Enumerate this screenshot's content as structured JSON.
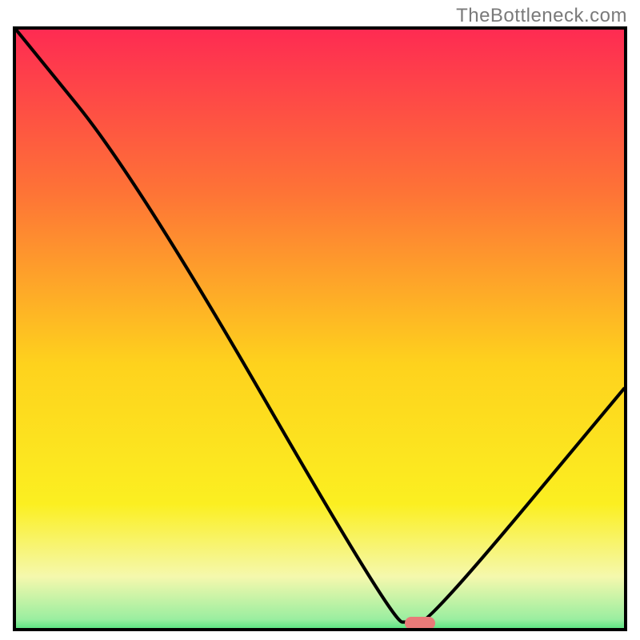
{
  "attribution": "TheBottleneck.com",
  "colors": {
    "frame": "#000000",
    "grad_top": "#fe2b52",
    "grad_upper_mid": "#fe8933",
    "grad_mid": "#fed21f",
    "grad_lower_mid": "#fbef21",
    "grad_pale": "#f5f8ad",
    "grad_green": "#1ddb65",
    "curve": "#000000",
    "marker": "#e87a78"
  },
  "layout": {
    "frame_left": 16,
    "frame_top": 33,
    "frame_width": 768,
    "frame_height": 756
  },
  "chart_data": {
    "type": "line",
    "title": "",
    "xlabel": "",
    "ylabel": "",
    "xlim": [
      0,
      100
    ],
    "ylim": [
      0,
      100
    ],
    "series": [
      {
        "name": "bottleneck-curve",
        "x": [
          0,
          20,
          62,
          65,
          68,
          100
        ],
        "values": [
          100,
          75,
          1,
          1,
          1,
          40
        ]
      }
    ],
    "marker": {
      "x_center": 66.5,
      "y": 0.8,
      "width_pct": 5
    },
    "background_gradient_stops": [
      {
        "pct": 0,
        "color": "#fe2b52"
      },
      {
        "pct": 27,
        "color": "#fe7436"
      },
      {
        "pct": 55,
        "color": "#fed21d"
      },
      {
        "pct": 78,
        "color": "#fbef21"
      },
      {
        "pct": 90,
        "color": "#f5f8ad"
      },
      {
        "pct": 97,
        "color": "#9aeea0"
      },
      {
        "pct": 100,
        "color": "#1ddb65"
      }
    ]
  }
}
